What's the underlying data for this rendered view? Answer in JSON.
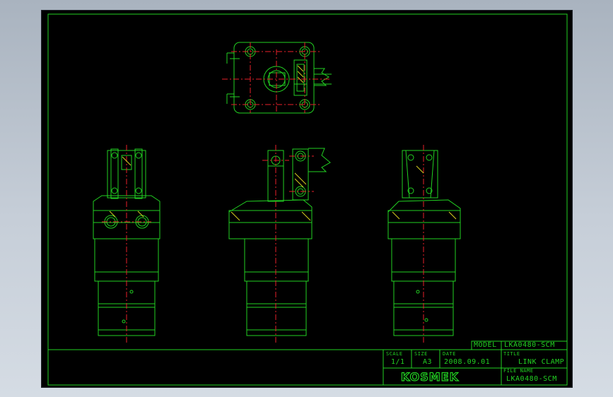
{
  "title_block": {
    "model_label": "MODEL",
    "model_value": "LKA0480-SCM",
    "scale_label": "SCALE",
    "scale_value": "1/1",
    "size_label": "SIZE",
    "size_value": "A3",
    "date_label": "DATE",
    "date_value": "2008.09.01",
    "title_label": "TITLE",
    "title_value": "LINK CLAMP",
    "filename_label": "FILE NAME",
    "filename_value": "LKA0480-SCM",
    "logo": "KOSMEK"
  },
  "colors": {
    "background": "#000000",
    "outline": "#22d122",
    "centerline": "#e8202a",
    "hatch": "#d8d020",
    "page": "#bfc8d2"
  }
}
